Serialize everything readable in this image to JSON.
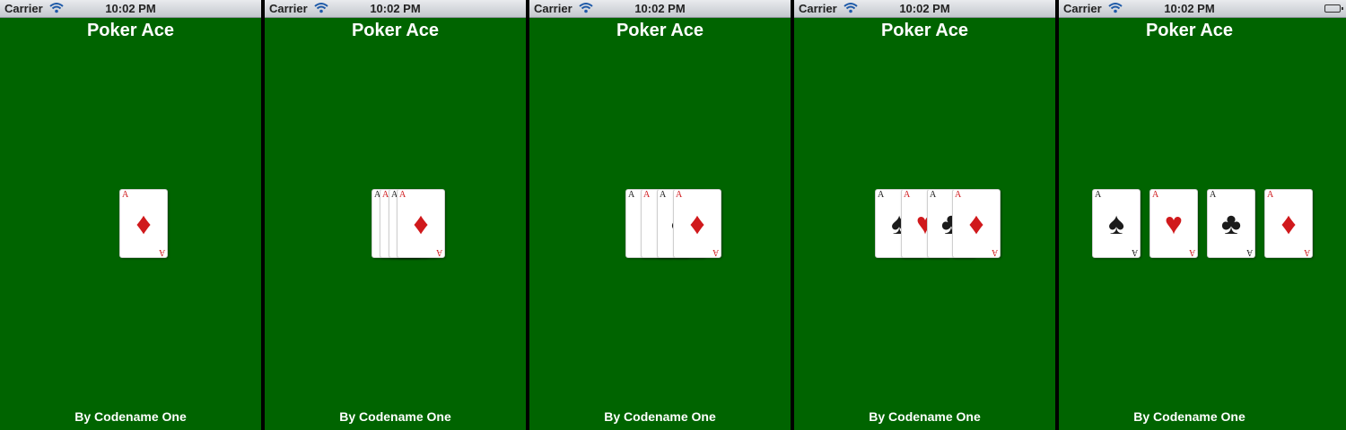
{
  "status": {
    "carrier": "Carrier",
    "time": "10:02 PM",
    "battery_level": 1.0
  },
  "app": {
    "title": "Poker Ace",
    "footer": "By Codename One"
  },
  "card": {
    "rank": "A"
  },
  "icons": {
    "wifi": "wifi-icon",
    "battery": "battery-icon",
    "spade": "spade-icon",
    "heart": "heart-icon",
    "club": "club-icon",
    "diamond": "diamond-icon"
  },
  "colors": {
    "felt": "#006400",
    "red_suit": "#d0191c",
    "black_suit": "#1b1b1b"
  }
}
